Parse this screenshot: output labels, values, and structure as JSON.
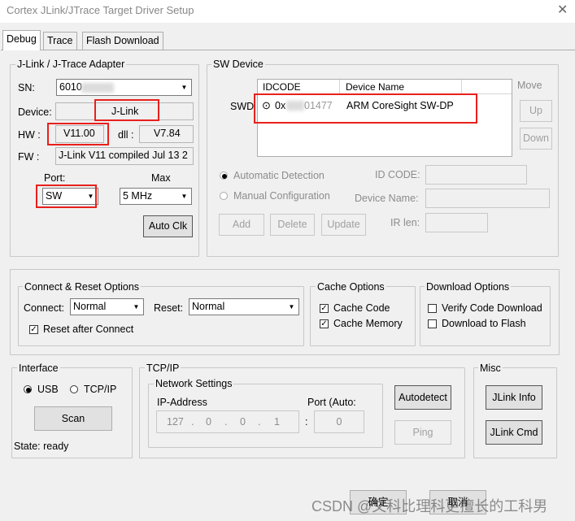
{
  "window": {
    "title": "Cortex JLink/JTrace Target Driver Setup",
    "close_glyph": "✕"
  },
  "tabs": [
    "Debug",
    "Trace",
    "Flash Download"
  ],
  "adapter": {
    "group_label": "J-Link / J-Trace Adapter",
    "sn_label": "SN:",
    "sn_value": "6010",
    "device_label": "Device:",
    "device_value": "J-Link",
    "hw_label": "HW :",
    "hw_value": "V11.00",
    "dll_label": "dll :",
    "dll_value": "V7.84",
    "fw_label": "FW :",
    "fw_value": "J-Link V11 compiled Jul 13 2",
    "port_label": "Port:",
    "port_value": "SW",
    "max_label": "Max",
    "max_value": "5 MHz",
    "autoclk_label": "Auto Clk"
  },
  "sw_device": {
    "group_label": "SW Device",
    "col_idcode": "IDCODE",
    "col_device_name": "Device Name",
    "row_prefix": "SWD",
    "row_idcode_visible": "0x",
    "row_idcode_tail": "01477",
    "row_device_name": "ARM CoreSight SW-DP",
    "move_label": "Move",
    "up_label": "Up",
    "down_label": "Down",
    "auto_detect_label": "Automatic Detection",
    "manual_config_label": "Manual Configuration",
    "id_code_label": "ID CODE:",
    "device_name_label": "Device Name:",
    "ir_len_label": "IR len:",
    "add_label": "Add",
    "delete_label": "Delete",
    "update_label": "Update"
  },
  "connect_reset": {
    "group_label": "Connect & Reset Options",
    "connect_label": "Connect:",
    "connect_value": "Normal",
    "reset_label": "Reset:",
    "reset_value": "Normal",
    "reset_after_connect_label": "Reset after Connect",
    "reset_after_connect_checked": true
  },
  "cache": {
    "group_label": "Cache Options",
    "cache_code_label": "Cache Code",
    "cache_code_checked": true,
    "cache_memory_label": "Cache Memory",
    "cache_memory_checked": true
  },
  "download": {
    "group_label": "Download Options",
    "verify_label": "Verify Code Download",
    "verify_checked": false,
    "download_flash_label": "Download to Flash",
    "download_flash_checked": false
  },
  "interface": {
    "group_label": "Interface",
    "usb_label": "USB",
    "tcpip_label": "TCP/IP",
    "scan_label": "Scan",
    "state_label": "State: ready"
  },
  "tcpip": {
    "group_label": "TCP/IP",
    "network_settings_label": "Network Settings",
    "ip_label": "IP-Address",
    "port_label": "Port (Auto:",
    "ip_octets": [
      "127",
      "0",
      "0",
      "1"
    ],
    "port_value": "0",
    "autodetect_label": "Autodetect",
    "ping_label": "Ping"
  },
  "misc": {
    "group_label": "Misc",
    "jlink_info_label": "JLink Info",
    "jlink_cmd_label": "JLink Cmd"
  },
  "footer": {
    "ok_label": "确定",
    "cancel_label": "取消"
  },
  "watermark": "CSDN @文科比理科更擅长的工科男",
  "colors": {
    "highlight": "#e8201c",
    "window_bg": "#f0f0f0"
  }
}
